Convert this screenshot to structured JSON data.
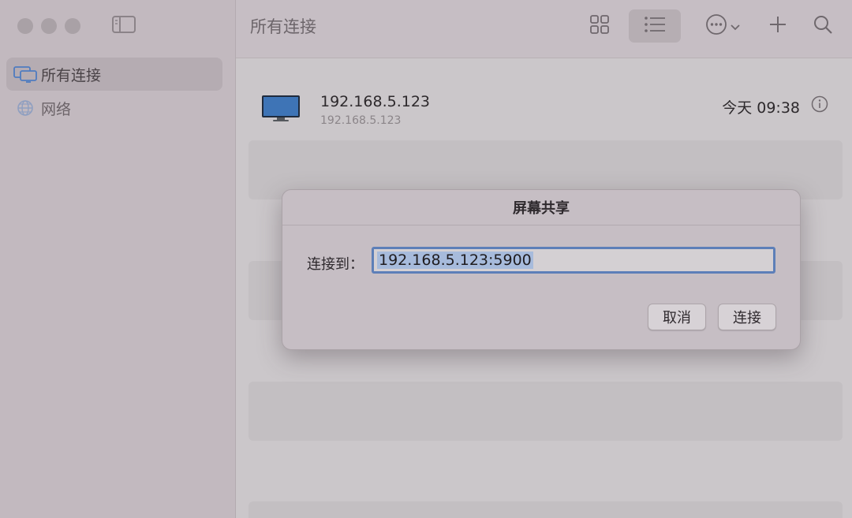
{
  "sidebar": {
    "items": [
      {
        "label": "所有连接",
        "icon": "screens-icon"
      },
      {
        "label": "网络",
        "icon": "globe-icon"
      }
    ]
  },
  "toolbar": {
    "title": "所有连接"
  },
  "connections": [
    {
      "name": "192.168.5.123",
      "address": "192.168.5.123",
      "time": "今天 09:38"
    }
  ],
  "dialog": {
    "title": "屏幕共享",
    "label": "连接到：",
    "value": "192.168.5.123:5900",
    "cancel_label": "取消",
    "connect_label": "连接"
  },
  "colors": {
    "accent": "#5d7fb8",
    "selection": "#a7bbdc"
  }
}
